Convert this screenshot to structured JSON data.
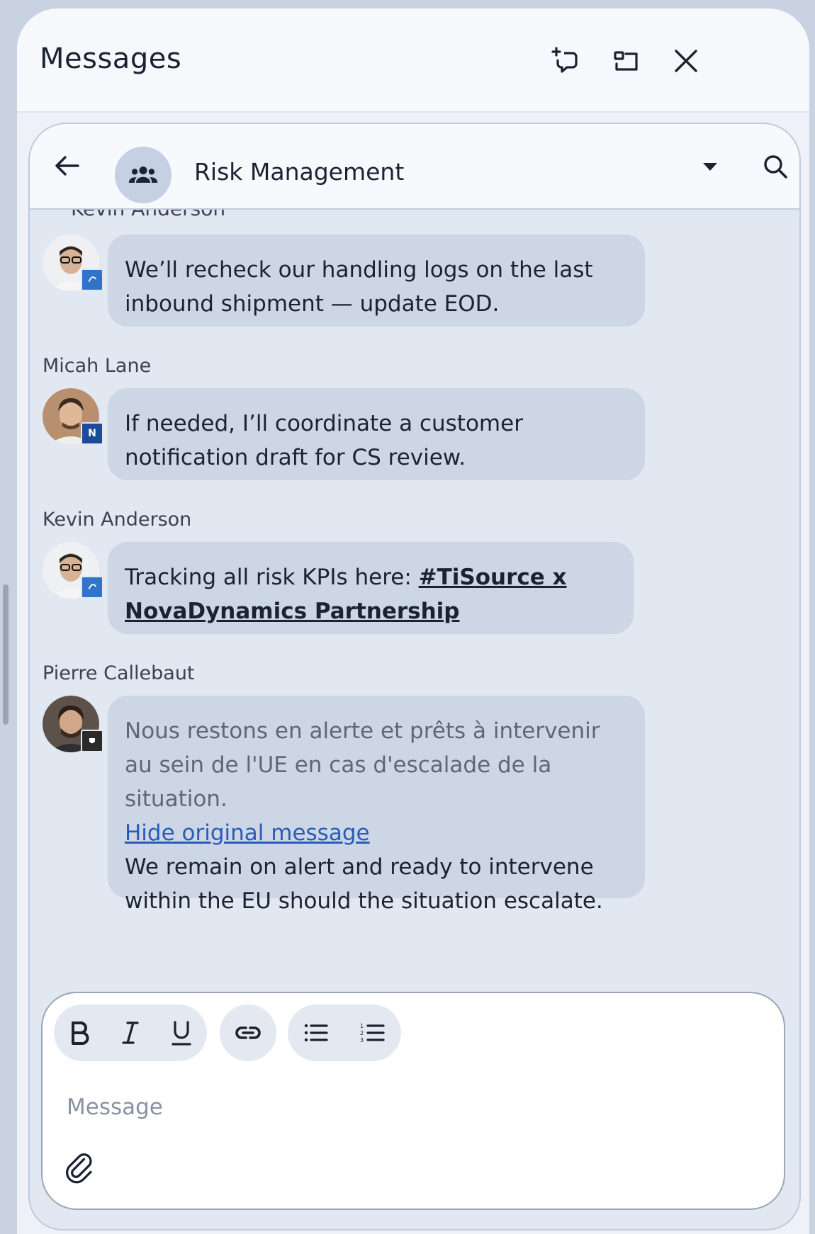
{
  "panel": {
    "title": "Messages",
    "icons": [
      "new-chat-icon",
      "expand-window-icon",
      "close-icon"
    ]
  },
  "chat": {
    "title": "Risk Management",
    "group_icon": "group-icon",
    "clipped_sender": "Kevin Anderson"
  },
  "messages": [
    {
      "sender": "Kevin Anderson",
      "text": "We’ll recheck our handling logs on the last inbound shipment — update EOD.",
      "avatar_bg": "#d7c2ab",
      "badge_color": "#2f74c9"
    },
    {
      "sender": "Micah Lane",
      "text": "If needed, I’ll coordinate a customer notification draft for CS review.",
      "avatar_bg": "#b8906f",
      "badge_color": "#1e4a9c"
    },
    {
      "sender": "Kevin Anderson",
      "text_prefix": "Tracking all risk KPIs here: ",
      "link_text": "#TiSource x NovaDynamics Partnership",
      "avatar_bg": "#d7c2ab",
      "badge_color": "#2f74c9"
    },
    {
      "sender": "Pierre Callebaut",
      "original_text": "Nous restons en alerte et prêts à intervenir au sein de l'UE en cas d'escalade de la situation.",
      "hide_link": "Hide original message",
      "translated_text": "We remain on alert and ready to intervene within the EU should the situation escalate.",
      "avatar_bg": "#6b5a4e",
      "badge_color": "#2a2a2a"
    }
  ],
  "composer": {
    "placeholder": "Message",
    "format_buttons": [
      "bold-icon",
      "italic-icon",
      "underline-icon",
      "link-icon",
      "bullet-list-icon",
      "numbered-list-icon"
    ],
    "attach_icon": "paperclip-icon"
  },
  "colors": {
    "bubble": "#cdd6e5",
    "chat_bg": "#e2e8f2",
    "link_blue": "#2a5bb8"
  }
}
